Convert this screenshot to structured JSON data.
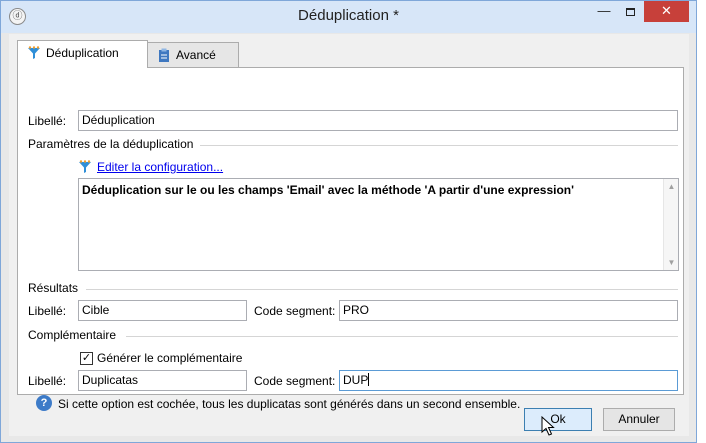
{
  "window": {
    "title": "Déduplication *",
    "app_icon": "app-logo-icon",
    "minimize": "—",
    "close": "✕"
  },
  "tabs": [
    {
      "label": "Déduplication",
      "icon": "funnel-icon",
      "active": true
    },
    {
      "label": "Avancé",
      "icon": "clipboard-icon",
      "active": false
    }
  ],
  "form": {
    "libelle_label": "Libellé:",
    "libelle_value": "Déduplication",
    "params_section": "Paramètres de la déduplication",
    "edit_link": "Editer la configuration...",
    "config_text": "Déduplication sur le ou les champs 'Email' avec la méthode 'A partir d'une expression'",
    "results_section": "Résultats",
    "results_libelle_label": "Libellé:",
    "results_libelle_value": "Cible",
    "results_segment_label": "Code segment:",
    "results_segment_value": "PRO",
    "comp_section": "Complémentaire",
    "comp_checkbox_label": "Générer le complémentaire",
    "comp_checkbox_checked": true,
    "comp_libelle_label": "Libellé:",
    "comp_libelle_value": "Duplicatas",
    "comp_segment_label": "Code segment:",
    "comp_segment_value": "DUP",
    "help_text": "Si cette option est cochée, tous les duplicatas sont générés dans un second ensemble."
  },
  "buttons": {
    "ok": "Ok",
    "cancel": "Annuler"
  },
  "colors": {
    "titlebar": "#d7e6f8",
    "close_button": "#c7403a",
    "link": "#0000ee",
    "ok_focus_border": "#3c7fb1"
  }
}
